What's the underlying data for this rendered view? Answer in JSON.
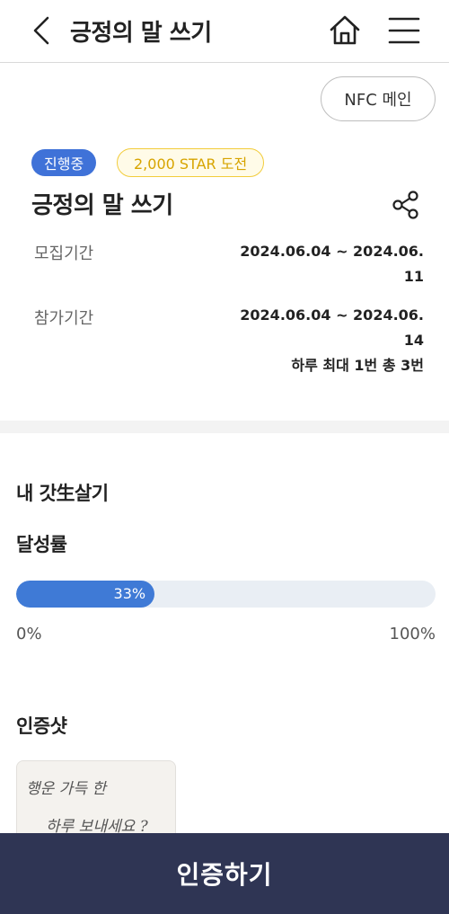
{
  "header": {
    "title": "긍정의 말 쓰기",
    "back_icon": "chevron-left-icon",
    "home_icon": "home-icon",
    "menu_icon": "hamburger-menu-icon"
  },
  "nfc_button": {
    "label": "NFC 메인"
  },
  "challenge": {
    "status_badge": "진행중",
    "reward_badge": "2,000 STAR 도전",
    "title": "긍정의 말 쓰기",
    "share_icon": "share-icon",
    "recruit": {
      "label": "모집기간",
      "value": "2024.06.04 ~ 2024.06.11"
    },
    "participate": {
      "label": "참가기간",
      "value": "2024.06.04 ~ 2024.06.14",
      "limit": "하루 최대 1번 총 3번"
    }
  },
  "my_section": {
    "heading": "내 갓生살기",
    "achievement": {
      "label": "달성률",
      "percent": 33,
      "percent_text": "33%",
      "min_label": "0%",
      "max_label": "100%"
    },
    "proof": {
      "heading": "인증샷",
      "handwriting_line1": "행운 가득 한",
      "handwriting_line2": "하루 보내세요 ?"
    }
  },
  "bottom_button": {
    "label": "인증하기"
  },
  "colors": {
    "accent": "#3f72d8",
    "progress": "#3f7ad6",
    "star_badge": "#f2cc3b",
    "bottom_bar": "#2f3554"
  }
}
